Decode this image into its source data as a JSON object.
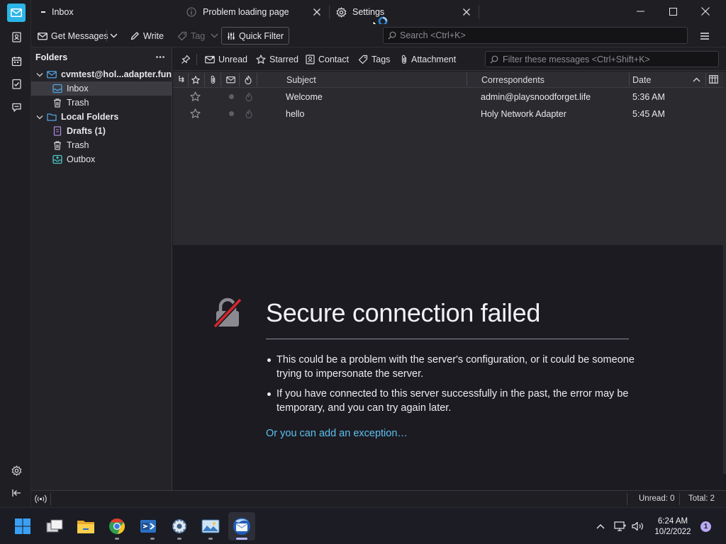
{
  "tabs": [
    {
      "label": "Inbox",
      "icon": "mail-tab-icon"
    },
    {
      "label": "Problem loading page",
      "icon": "info-icon"
    },
    {
      "label": "Settings",
      "icon": "gear-icon"
    }
  ],
  "toolbar": {
    "get_messages": "Get Messages",
    "write": "Write",
    "tag": "Tag",
    "quick_filter": "Quick Filter",
    "search_placeholder": "Search <Ctrl+K>"
  },
  "folders": {
    "header": "Folders",
    "account": "cvmtest@hol...adapter.fun",
    "account_items": [
      "Inbox",
      "Trash"
    ],
    "local_folders": "Local Folders",
    "local_items": [
      "Drafts (1)",
      "Trash",
      "Outbox"
    ]
  },
  "quickfilter": {
    "unread": "Unread",
    "starred": "Starred",
    "contact": "Contact",
    "tags": "Tags",
    "attachment": "Attachment",
    "filter_placeholder": "Filter these messages <Ctrl+Shift+K>"
  },
  "thread": {
    "columns": {
      "subject": "Subject",
      "correspondents": "Correspondents",
      "date": "Date"
    },
    "rows": [
      {
        "subject": "Welcome",
        "correspondent": "admin@playsnoodforget.life",
        "date": "5:36 AM"
      },
      {
        "subject": "hello",
        "correspondent": "Holy Network Adapter",
        "date": "5:45 AM"
      }
    ]
  },
  "error": {
    "title": "Secure connection failed",
    "bullets": [
      "This could be a problem with the server's configuration, or it could be someone trying to impersonate the server.",
      "If you have connected to this server successfully in the past, the error may be temporary, and you can try again later."
    ],
    "exception_link": "Or you can add an exception…"
  },
  "status": {
    "unread": "Unread: 0",
    "total": "Total: 2"
  },
  "taskbar": {
    "time": "6:24 AM",
    "date": "10/2/2022",
    "notifications": "1",
    "apps": [
      "start-button",
      "task-view",
      "file-explorer",
      "chrome",
      "visual-studio",
      "settings",
      "photos",
      "thunderbird"
    ]
  },
  "colors": {
    "accent": "#2cb5e8",
    "link": "#5cc1ee",
    "error_slash": "#d7262b"
  }
}
